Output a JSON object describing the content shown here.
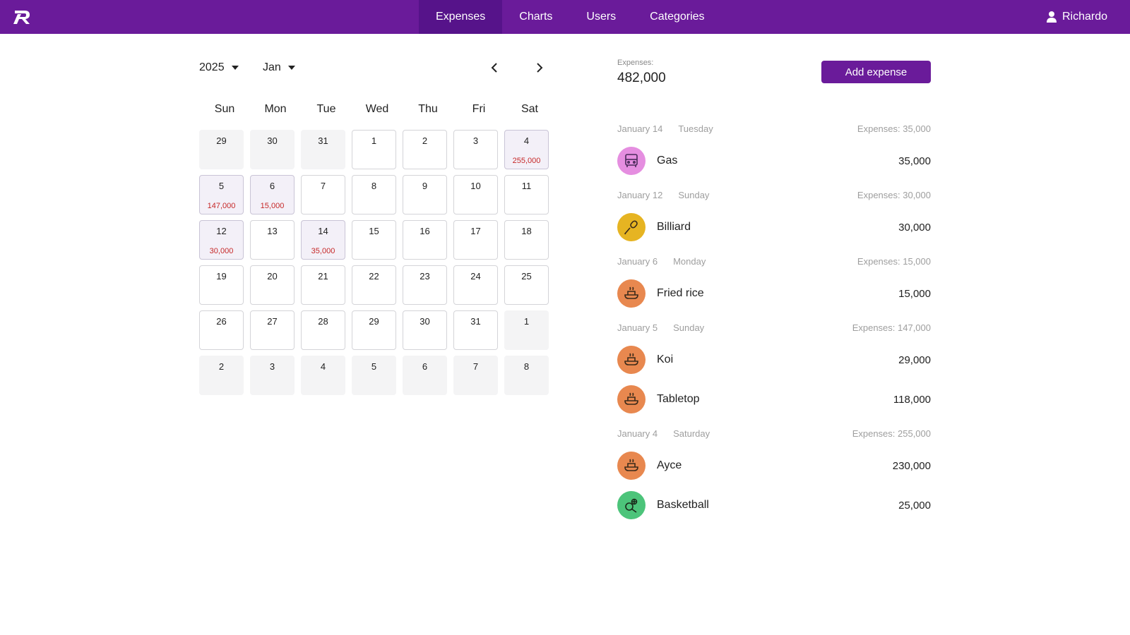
{
  "nav": {
    "tabs": [
      {
        "label": "Expenses",
        "active": true
      },
      {
        "label": "Charts",
        "active": false
      },
      {
        "label": "Users",
        "active": false
      },
      {
        "label": "Categories",
        "active": false
      }
    ],
    "user": "Richardo"
  },
  "colors": {
    "brand": "#6a1b9a",
    "expense_amount": "#c62828"
  },
  "calendar": {
    "year": "2025",
    "month": "Jan",
    "weekdays": [
      "Sun",
      "Mon",
      "Tue",
      "Wed",
      "Thu",
      "Fri",
      "Sat"
    ],
    "days": [
      {
        "day": "29",
        "other": true
      },
      {
        "day": "30",
        "other": true
      },
      {
        "day": "31",
        "other": true
      },
      {
        "day": "1"
      },
      {
        "day": "2"
      },
      {
        "day": "3"
      },
      {
        "day": "4",
        "amount": "255,000"
      },
      {
        "day": "5",
        "amount": "147,000"
      },
      {
        "day": "6",
        "amount": "15,000"
      },
      {
        "day": "7"
      },
      {
        "day": "8"
      },
      {
        "day": "9"
      },
      {
        "day": "10"
      },
      {
        "day": "11"
      },
      {
        "day": "12",
        "amount": "30,000"
      },
      {
        "day": "13"
      },
      {
        "day": "14",
        "amount": "35,000"
      },
      {
        "day": "15"
      },
      {
        "day": "16"
      },
      {
        "day": "17"
      },
      {
        "day": "18"
      },
      {
        "day": "19"
      },
      {
        "day": "20"
      },
      {
        "day": "21"
      },
      {
        "day": "22"
      },
      {
        "day": "23"
      },
      {
        "day": "24"
      },
      {
        "day": "25"
      },
      {
        "day": "26"
      },
      {
        "day": "27"
      },
      {
        "day": "28"
      },
      {
        "day": "29"
      },
      {
        "day": "30"
      },
      {
        "day": "31"
      },
      {
        "day": "1",
        "other": true
      },
      {
        "day": "2",
        "other": true
      },
      {
        "day": "3",
        "other": true
      },
      {
        "day": "4",
        "other": true
      },
      {
        "day": "5",
        "other": true
      },
      {
        "day": "6",
        "other": true
      },
      {
        "day": "7",
        "other": true
      },
      {
        "day": "8",
        "other": true
      }
    ]
  },
  "summary": {
    "label": "Expenses:",
    "total": "482,000",
    "add_button": "Add expense"
  },
  "groups": [
    {
      "date": "January 14",
      "weekday": "Tuesday",
      "total": "Expenses: 35,000",
      "items": [
        {
          "name": "Gas",
          "amount": "35,000",
          "icon": "bus-icon",
          "color": "#e58ee0"
        }
      ]
    },
    {
      "date": "January 12",
      "weekday": "Sunday",
      "total": "Expenses: 30,000",
      "items": [
        {
          "name": "Billiard",
          "amount": "30,000",
          "icon": "microphone-icon",
          "color": "#e6b422"
        }
      ]
    },
    {
      "date": "January 6",
      "weekday": "Monday",
      "total": "Expenses: 15,000",
      "items": [
        {
          "name": "Fried rice",
          "amount": "15,000",
          "icon": "food-icon",
          "color": "#e8884f"
        }
      ]
    },
    {
      "date": "January 5",
      "weekday": "Sunday",
      "total": "Expenses: 147,000",
      "items": [
        {
          "name": "Koi",
          "amount": "29,000",
          "icon": "food-icon",
          "color": "#e8884f"
        },
        {
          "name": "Tabletop",
          "amount": "118,000",
          "icon": "food-icon",
          "color": "#e8884f"
        }
      ]
    },
    {
      "date": "January 4",
      "weekday": "Saturday",
      "total": "Expenses: 255,000",
      "items": [
        {
          "name": "Ayce",
          "amount": "230,000",
          "icon": "food-icon",
          "color": "#e8884f"
        },
        {
          "name": "Basketball",
          "amount": "25,000",
          "icon": "sports-icon",
          "color": "#4cc47a"
        }
      ]
    }
  ]
}
